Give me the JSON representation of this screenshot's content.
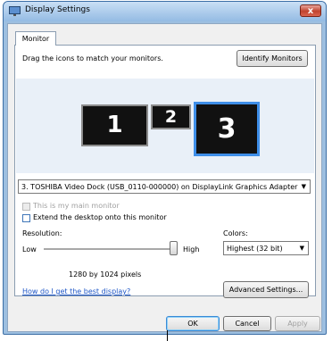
{
  "window": {
    "title": "Display Settings",
    "close_glyph": "x",
    "tab": "Monitor"
  },
  "monitor_tab": {
    "instruction": "Drag the icons to match your monitors.",
    "identify_button": "Identify Monitors",
    "monitors": [
      "1",
      "2",
      "3"
    ],
    "selected_monitor": "3",
    "device_select": "3. TOSHIBA Video Dock (USB_0110-000000) on DisplayLink Graphics Adapter",
    "main_monitor_label": "This is my main monitor",
    "main_monitor_checked": false,
    "main_monitor_enabled": false,
    "extend_label": "Extend the desktop onto this monitor",
    "extend_checked": false,
    "resolution": {
      "label": "Resolution:",
      "low": "Low",
      "high": "High",
      "value_text": "1280 by 1024 pixels",
      "slider_fraction": 0.97
    },
    "colors": {
      "label": "Colors:",
      "value": "Highest (32 bit)"
    },
    "help_link": "How do I get the best display?",
    "advanced_button": "Advanced Settings..."
  },
  "footer": {
    "ok": "OK",
    "cancel": "Cancel",
    "apply": "Apply"
  },
  "colors_theme": {
    "selected_border": "#3e8ee8",
    "link": "#1f57c7",
    "close_button": "#c1432e"
  },
  "icons": [
    "display-settings-icon",
    "close-icon",
    "dropdown-arrow-icon"
  ]
}
